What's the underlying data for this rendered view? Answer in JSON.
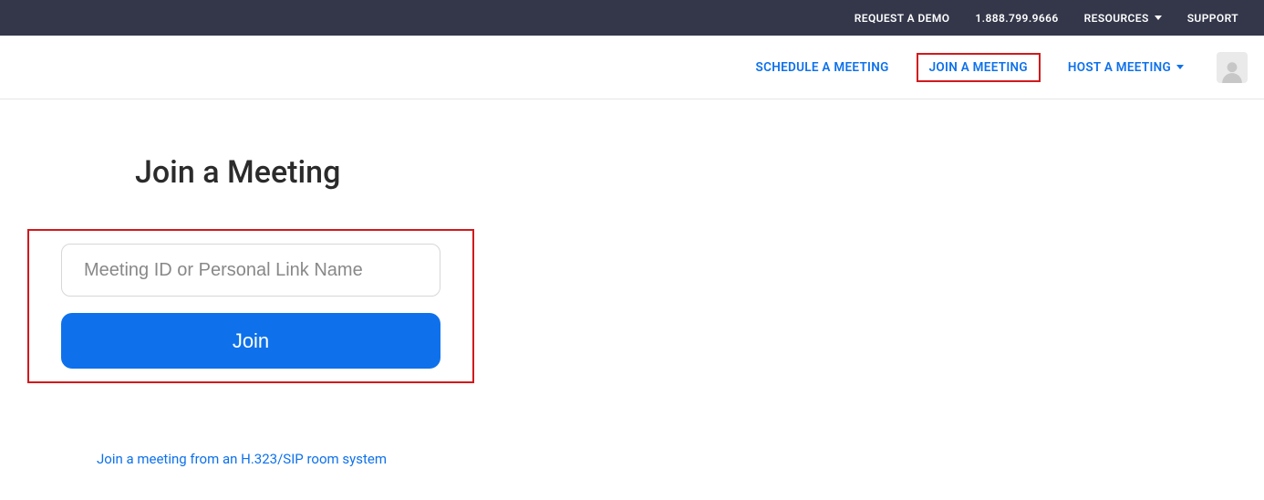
{
  "topbar": {
    "request_demo": "REQUEST A DEMO",
    "phone": "1.888.799.9666",
    "resources": "RESOURCES",
    "support": "SUPPORT"
  },
  "nav": {
    "schedule": "SCHEDULE A MEETING",
    "join": "JOIN A MEETING",
    "host": "HOST A MEETING"
  },
  "main": {
    "title": "Join a Meeting",
    "input_placeholder": "Meeting ID or Personal Link Name",
    "input_value": "",
    "join_button": "Join",
    "room_link": "Join a meeting from an H.323/SIP room system"
  }
}
